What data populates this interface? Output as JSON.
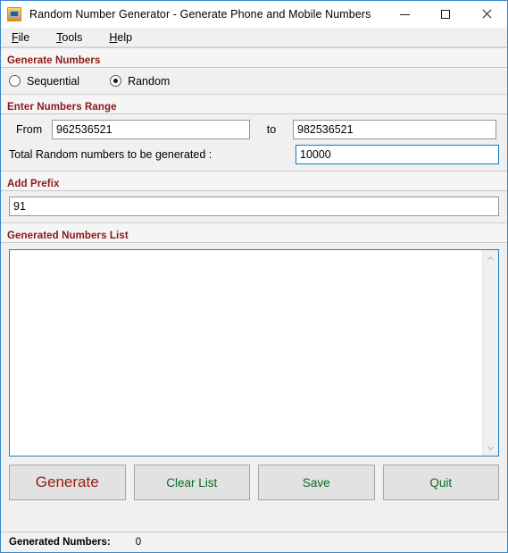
{
  "window": {
    "title": "Random Number Generator - Generate Phone and Mobile Numbers",
    "icon": "calculator-icon",
    "controls": {
      "minimize": "minimize-icon",
      "maximize": "maximize-icon",
      "close": "close-icon"
    }
  },
  "menubar": {
    "items": [
      {
        "accel": "F",
        "rest": "ile"
      },
      {
        "accel": "T",
        "rest": "ools"
      },
      {
        "accel": "H",
        "rest": "elp"
      }
    ]
  },
  "generate_numbers": {
    "header": "Generate Numbers",
    "options": [
      {
        "label": "Sequential",
        "selected": false
      },
      {
        "label": "Random",
        "selected": true
      }
    ]
  },
  "numbers_range": {
    "header": "Enter Numbers Range",
    "from_label": "From",
    "from_value": "962536521",
    "to_label": "to",
    "to_value": "982536521",
    "total_label": "Total Random numbers to be generated :",
    "total_value": "10000"
  },
  "add_prefix": {
    "header": "Add Prefix",
    "value": "91"
  },
  "generated_list": {
    "header": "Generated Numbers List",
    "content": "",
    "scroll_up_icon": "chevron-up-icon",
    "scroll_down_icon": "chevron-down-icon"
  },
  "buttons": {
    "generate": "Generate",
    "clear_list": "Clear List",
    "save": "Save",
    "quit": "Quit"
  },
  "statusbar": {
    "label": "Generated Numbers:",
    "value": "0"
  },
  "colors": {
    "header_red": "#8f1515",
    "generate_red": "#9b1b12",
    "button_green": "#0a6b1f",
    "focus_blue": "#0d7ac4",
    "window_border": "#3a87c8"
  }
}
